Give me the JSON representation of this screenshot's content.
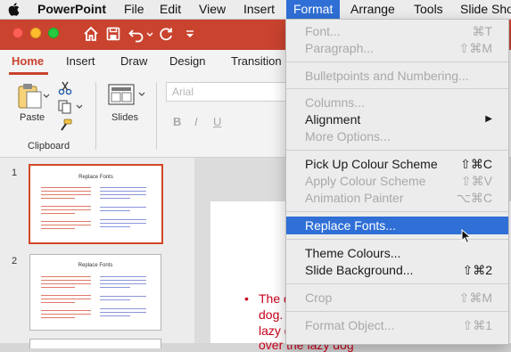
{
  "menubar": {
    "items": [
      "PowerPoint",
      "File",
      "Edit",
      "View",
      "Insert",
      "Format",
      "Arrange",
      "Tools",
      "Slide Sho"
    ],
    "active": "Format"
  },
  "ribbon": {
    "tabs": [
      "Home",
      "Insert",
      "Draw",
      "Design",
      "Transition"
    ],
    "selected_tab": "Home",
    "paste_label": "Paste",
    "clipboard_label": "Clipboard",
    "slides_label": "Slides",
    "font_placeholder": "Arial",
    "bold": "B",
    "italic": "I",
    "underline": "U"
  },
  "slides": [
    {
      "number": "1",
      "title": "Replace Fonts"
    },
    {
      "number": "2",
      "title": "Replace Fonts"
    }
  ],
  "canvas": {
    "bullet": "•",
    "lines": [
      "The q",
      "dog.",
      "lazy d",
      "over the lazy dog"
    ],
    "partial_char": "e"
  },
  "format_menu": {
    "items": [
      {
        "label": "Font...",
        "shortcut": "⌘T",
        "enabled": false
      },
      {
        "label": "Paragraph...",
        "shortcut": "⇧⌘M",
        "enabled": false
      },
      {
        "label": "Bulletpoints and Numbering...",
        "shortcut": "",
        "enabled": false
      },
      {
        "label": "Columns...",
        "shortcut": "",
        "enabled": false
      },
      {
        "label": "Alignment",
        "shortcut": "▶",
        "enabled": true
      },
      {
        "label": "More Options...",
        "shortcut": "",
        "enabled": false
      },
      {
        "label": "Pick Up Colour Scheme",
        "shortcut": "⇧⌘C",
        "enabled": true
      },
      {
        "label": "Apply Colour Scheme",
        "shortcut": "⇧⌘V",
        "enabled": false
      },
      {
        "label": "Animation Painter",
        "shortcut": "⌥⌘C",
        "enabled": false
      },
      {
        "label": "Replace Fonts...",
        "shortcut": "",
        "enabled": true,
        "highlighted": true
      },
      {
        "label": "Theme Colours...",
        "shortcut": "",
        "enabled": true
      },
      {
        "label": "Slide Background...",
        "shortcut": "⇧⌘2",
        "enabled": true
      },
      {
        "label": "Crop",
        "shortcut": "⇧⌘M",
        "enabled": false
      },
      {
        "label": "Format Object...",
        "shortcut": "⇧⌘1",
        "enabled": false
      }
    ]
  },
  "colors": {
    "accent": "#c9432f",
    "menu_highlight": "#2f6fd6",
    "disabled_text": "#a9a9a9",
    "bullet_red": "#c9001b"
  }
}
